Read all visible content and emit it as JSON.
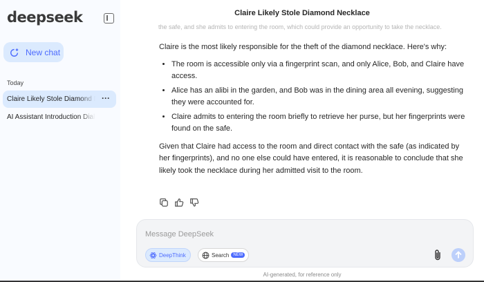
{
  "sidebar": {
    "logo": "deepseek",
    "new_chat_label": "New chat",
    "section_today": "Today",
    "history": [
      {
        "title": "Claire Likely Stole Diamond Necklace"
      },
      {
        "title": "AI Assistant Introduction Dialogue"
      }
    ],
    "more_label": "···"
  },
  "chat": {
    "title": "Claire Likely Stole Diamond Necklace",
    "faded_line": "the safe, and she admits to entering the room, which could provide an opportunity to take the necklace.",
    "intro": "Claire is the most likely responsible for the theft of the diamond necklace. Here's why:",
    "bullets": [
      "The room is accessible only via a fingerprint scan, and only Alice, Bob, and Claire have access.",
      "Alice has an alibi in the garden, and Bob was in the dining area all evening, suggesting they were accounted for.",
      "Claire admits to entering the room briefly to retrieve her purse, but her fingerprints were found on the safe."
    ],
    "conclusion": "Given that Claire had access to the room and direct contact with the safe (as indicated by her fingerprints), and no one else could have entered, it is reasonable to conclude that she likely took the necklace during her admitted visit to the room."
  },
  "composer": {
    "placeholder": "Message DeepSeek",
    "deepthink_label": "DeepThink",
    "search_label": "Search",
    "search_badge": "NEW"
  },
  "footer": "AI-generated, for reference only",
  "colors": {
    "accent": "#4d6bfe",
    "sidebar_bg": "#f9fbff",
    "active_bg": "#dbeafe"
  },
  "icons": [
    "collapse-sidebar-icon",
    "new-chat-icon",
    "copy-icon",
    "thumbs-up-icon",
    "thumbs-down-icon",
    "deepthink-icon",
    "globe-icon",
    "paperclip-icon",
    "send-arrow-icon"
  ]
}
